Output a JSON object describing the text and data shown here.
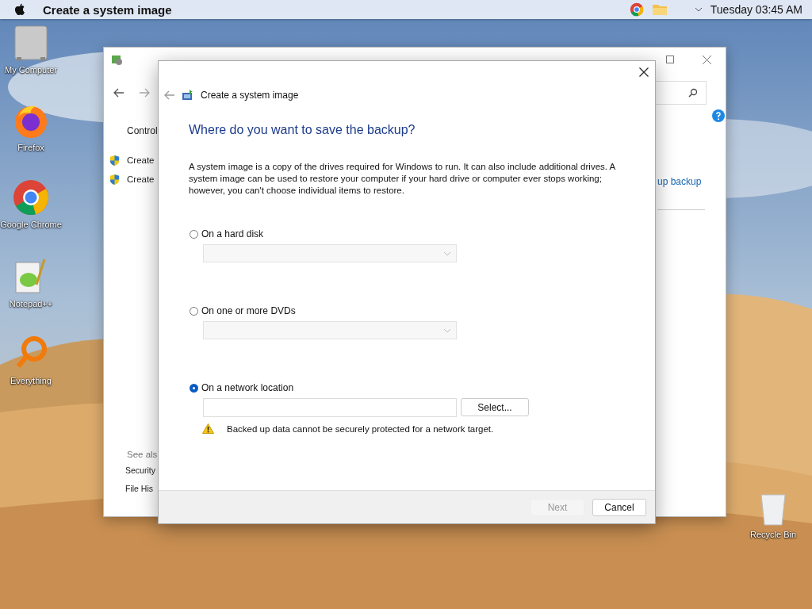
{
  "menu_bar": {
    "app_title": "Create a system image",
    "clock": "Tuesday 03:45 AM"
  },
  "desktop_icons": [
    {
      "label": "My Computer",
      "kind": "computer"
    },
    {
      "label": "Firefox",
      "kind": "firefox"
    },
    {
      "label": "Google Chrome",
      "kind": "chrome"
    },
    {
      "label": "Notepad++",
      "kind": "notepad"
    },
    {
      "label": "Everything",
      "kind": "search"
    },
    {
      "label": "Recycle Bin",
      "kind": "bin"
    }
  ],
  "back_window": {
    "nav_title": "Control",
    "tasks": [
      "Create",
      "Create"
    ],
    "link": "up backup",
    "see_also_heading": "See als",
    "see_also": [
      "Security",
      "File His"
    ]
  },
  "dialog": {
    "title": "Create a system image",
    "heading": "Where do you want to save the backup?",
    "description": "A system image is a copy of the drives required for Windows to run. It can also include additional drives. A system image can be used to restore your computer if your hard drive or computer ever stops working; however, you can't choose individual items to restore.",
    "options": [
      {
        "label": "On a hard disk",
        "selected": false,
        "kind": "dropdown",
        "disabled": true
      },
      {
        "label": "On one or more DVDs",
        "selected": false,
        "kind": "dropdown",
        "disabled": true
      },
      {
        "label": "On a network location",
        "selected": true,
        "kind": "path",
        "button": "Select...",
        "warning": "Backed up data cannot be securely protected for a network target."
      }
    ],
    "buttons": [
      {
        "label": "Next",
        "disabled": true
      },
      {
        "label": "Cancel",
        "disabled": false
      }
    ]
  }
}
